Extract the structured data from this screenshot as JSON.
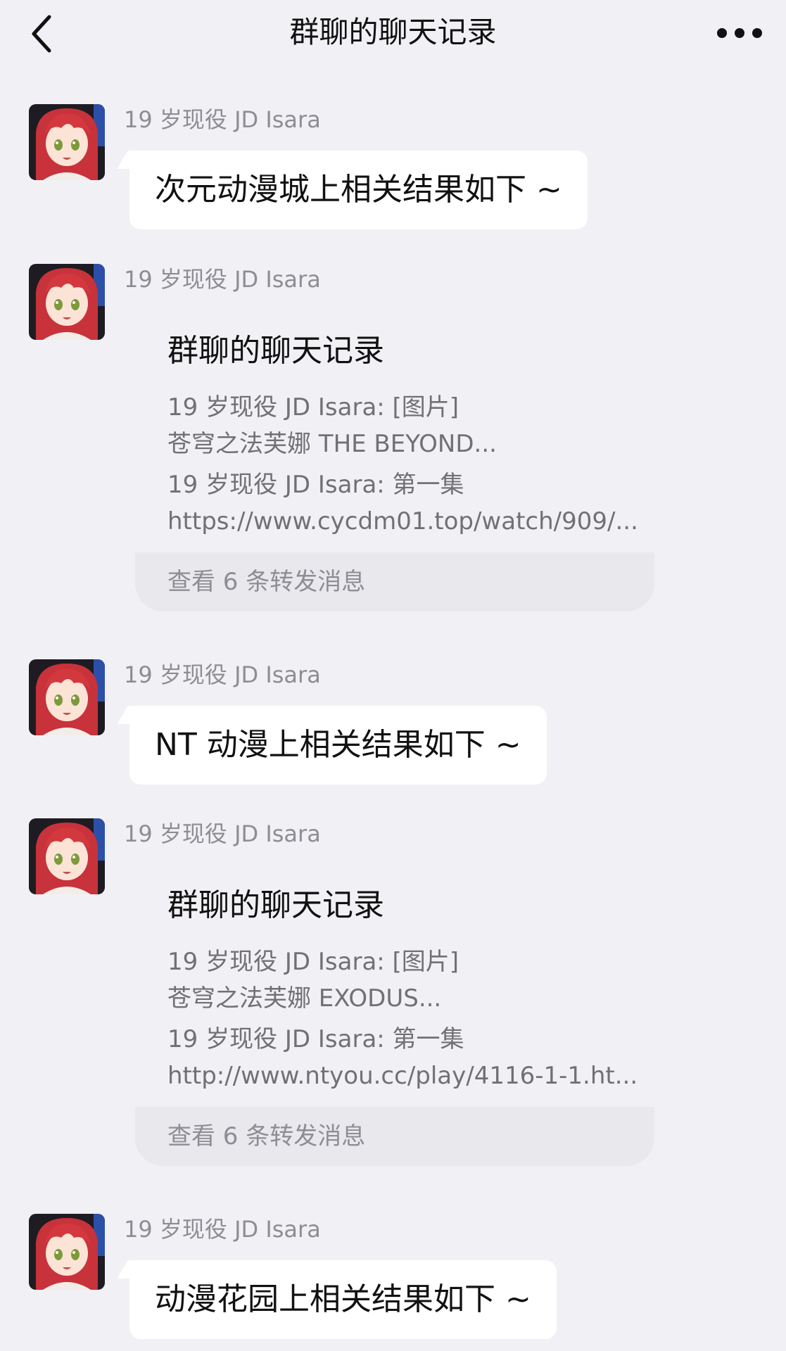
{
  "header": {
    "title": "群聊的聊天记录",
    "back_icon": "chevron-left-icon",
    "more_icon": "more-dots-icon"
  },
  "messages": [
    {
      "sender": "19 岁现役 JD Isara",
      "text": "次元动漫城上相关结果如下 ~"
    },
    {
      "sender": "19 岁现役 JD Isara",
      "card": {
        "title": "群聊的聊天记录",
        "lines": [
          "19 岁现役 JD Isara: [图片]",
          "苍穹之法芙娜 THE BEYOND...",
          "19 岁现役 JD Isara: 第一集",
          "https://www.cycdm01.top/watch/909/..."
        ],
        "footer": "查看 6 条转发消息"
      }
    },
    {
      "sender": "19 岁现役 JD Isara",
      "text": "NT 动漫上相关结果如下 ~"
    },
    {
      "sender": "19 岁现役 JD Isara",
      "card": {
        "title": "群聊的聊天记录",
        "lines": [
          "19 岁现役 JD Isara: [图片]",
          "苍穹之法芙娜 EXODUS...",
          "19 岁现役 JD Isara: 第一集",
          "http://www.ntyou.cc/play/4116-1-1.ht..."
        ],
        "footer": "查看 6 条转发消息"
      }
    },
    {
      "sender": "19 岁现役 JD Isara",
      "text": "动漫花园上相关结果如下 ~"
    }
  ]
}
